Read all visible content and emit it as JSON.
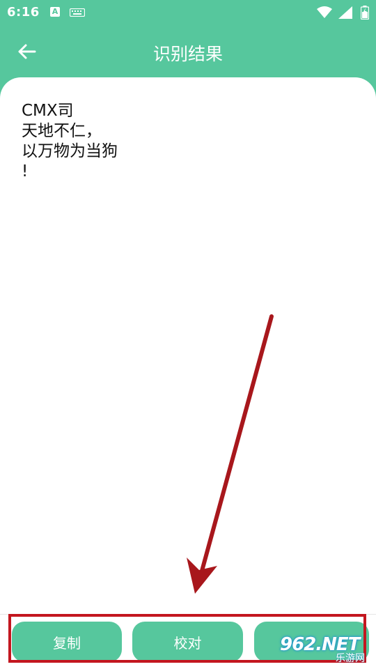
{
  "status_bar": {
    "time": "6:16",
    "notification_letter": "A",
    "icons": [
      "keyboard-icon",
      "wifi-icon",
      "signal-icon",
      "battery-icon"
    ]
  },
  "toolbar": {
    "title": "识别结果",
    "back_icon": "arrow-left-icon"
  },
  "result": {
    "lines": [
      "CMX司",
      "天地不仁，",
      "以万物为当狗",
      "!"
    ]
  },
  "actions": {
    "copy_label": "复制",
    "proofread_label": "校对",
    "third_label": ""
  },
  "watermark": {
    "logo": "962.NET",
    "sub": "乐游网"
  },
  "colors": {
    "primary": "#56c79d",
    "annotation_red": "#c3161f",
    "background": "#ffffff"
  }
}
